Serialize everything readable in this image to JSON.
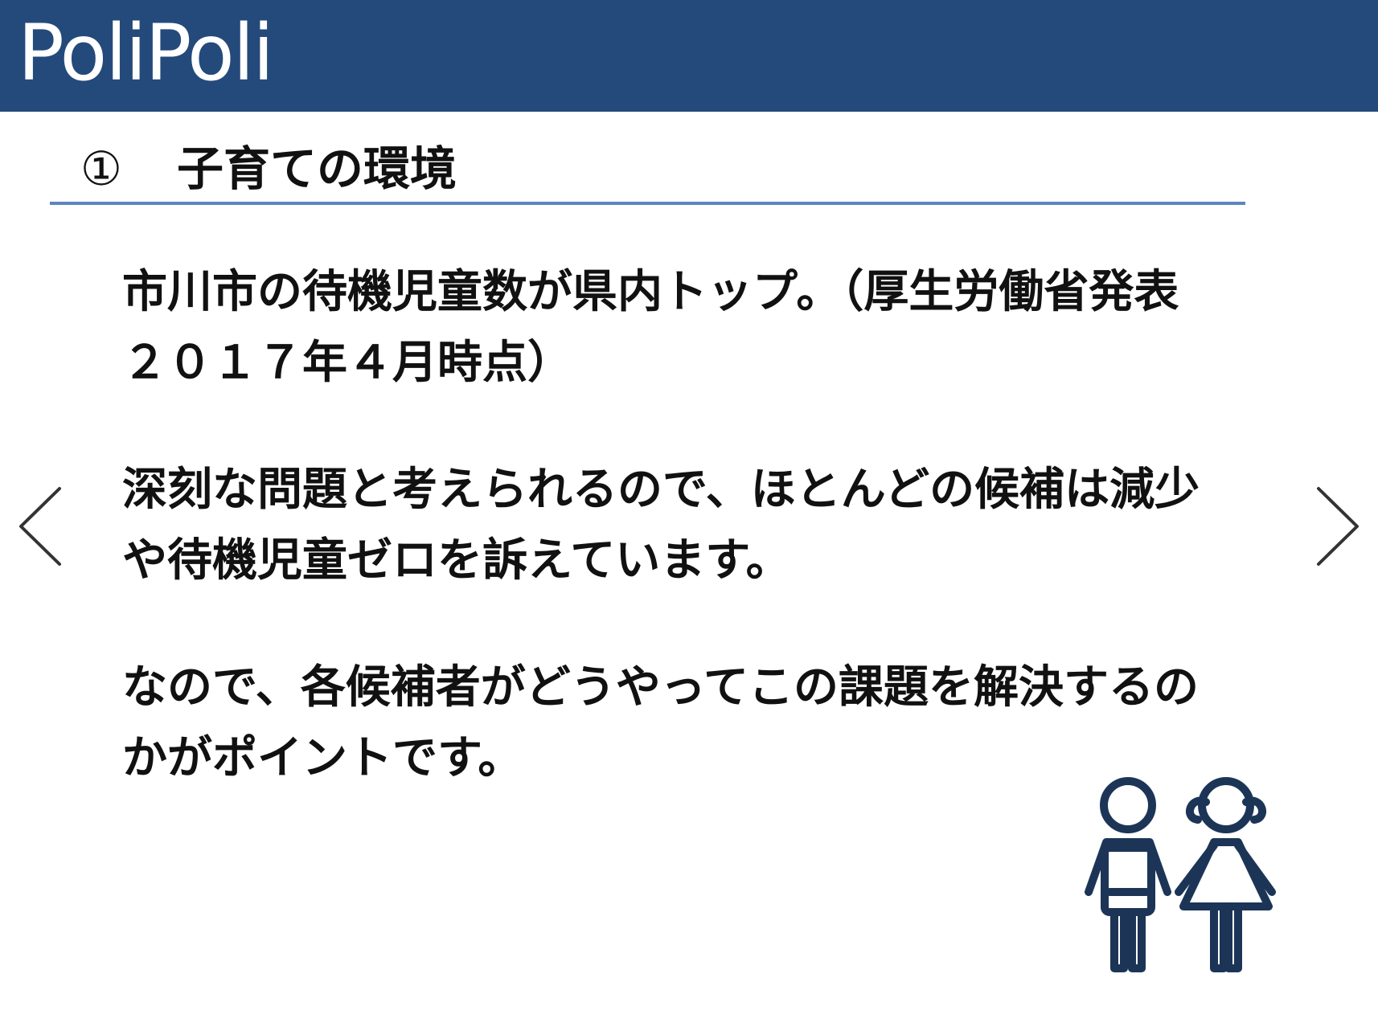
{
  "header": {
    "brand": "PoliPoli",
    "background_color": "#244a7b"
  },
  "section": {
    "number": "①",
    "title": "子育ての環境",
    "rule_color": "#5b85c1"
  },
  "paragraphs": [
    {
      "lines": [
        "市川市の待機児童数が県内トップ。（厚生労働省発表",
        "２０１７年４月時点）"
      ]
    },
    {
      "lines": [
        "深刻な問題と考えられるので、ほとんどの候補は減少",
        "や待機児童ゼロを訴えています。"
      ]
    },
    {
      "lines": [
        "なので、各候補者がどうやってこの課題を解決するの",
        "かがポイントです。"
      ]
    }
  ],
  "navigation": {
    "prev_icon": "chevron-left",
    "next_icon": "chevron-right"
  },
  "illustration": {
    "icon": "children-icon",
    "color": "#1c3557"
  }
}
